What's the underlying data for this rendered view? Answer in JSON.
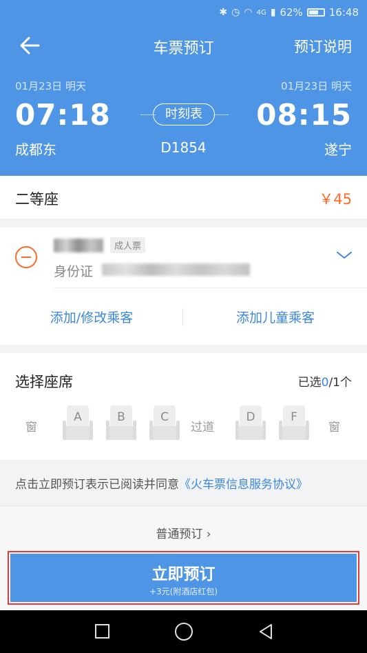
{
  "status_bar": {
    "network": "4G",
    "battery": "62%",
    "time": "16:48"
  },
  "nav": {
    "title": "车票预订",
    "help": "预订说明"
  },
  "trip": {
    "dep_date": "01月23日 明天",
    "arr_date": "01月23日 明天",
    "dep_time": "07:18",
    "arr_time": "08:15",
    "dep_station": "成都东",
    "arr_station": "遂宁",
    "train_no": "D1854",
    "timetable_label": "时刻表"
  },
  "seat": {
    "class_name": "二等座",
    "price": "￥45"
  },
  "passenger": {
    "ticket_type": "成人票",
    "id_type": "身份证",
    "add_passenger_label": "添加/修改乘客",
    "add_child_label": "添加儿童乘客"
  },
  "seat_selection": {
    "title": "选择座席",
    "count_prefix": "已选",
    "count_selected": "0",
    "count_suffix": "/1个",
    "window_left": "窗",
    "aisle": "过道",
    "window_right": "窗",
    "seats": [
      "A",
      "B",
      "C",
      "D",
      "F"
    ]
  },
  "agreement": {
    "text": "点击立即预订表示已阅读并同意",
    "link": "《火车票信息服务协议》"
  },
  "booking": {
    "normal_label": "普通预订 ›",
    "primary_label": "立即预订",
    "primary_sub": "+3元(附酒店红包)"
  },
  "colors": {
    "primary": "#4f95e6",
    "link": "#3c87dd",
    "price": "#ff6a2a",
    "highlight_border": "#e53a3a"
  }
}
